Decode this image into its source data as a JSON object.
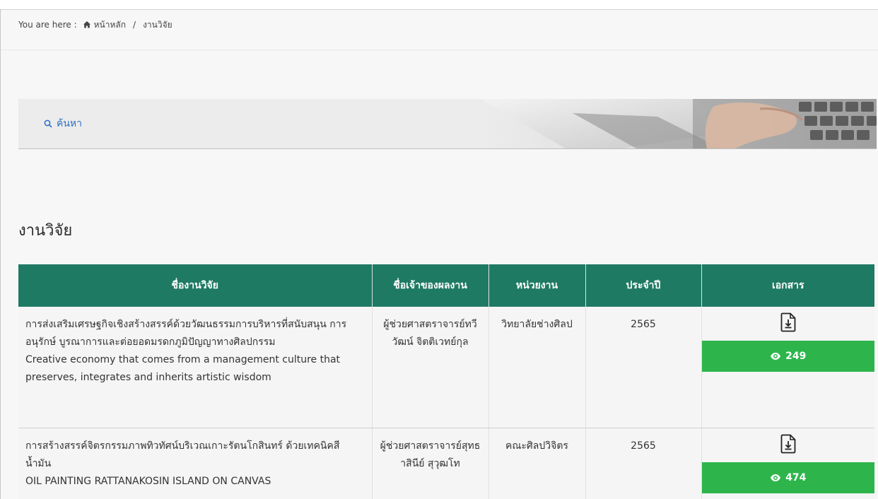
{
  "breadcrumb": {
    "prefix": "You are here :",
    "home_icon": "home-icon",
    "home_label": "หน้าหลัก",
    "separator": "/",
    "current": "งานวิจัย"
  },
  "search": {
    "icon": "search-icon",
    "label": "ค้นหา"
  },
  "section": {
    "title": "งานวิจัย"
  },
  "table": {
    "headers": [
      "ชื่องานวิจัย",
      "ชื่อเจ้าของผลงาน",
      "หน่วยงาน",
      "ประจำปี",
      "เอกสาร"
    ],
    "rows": [
      {
        "title_th": "การส่งเสริมเศรษฐกิจเชิงสร้างสรรค์ด้วยวัฒนธรรมการบริหารที่สนับสนุน การอนุรักษ์ บูรณาการและต่อยอดมรดกภูมิปัญญาทางศิลปกรรม",
        "title_en": "Creative economy that comes from a management culture that preserves, integrates and inherits artistic wisdom",
        "owner": "ผู้ช่วยศาสตราจารย์ทวีวัฒน์ จิตติเวทย์กุล",
        "department": "วิทยาลัยช่างศิลป",
        "year": "2565",
        "doc_icon": "file-download-icon",
        "views_icon": "eye-icon",
        "views": "249"
      },
      {
        "title_th": "การสร้างสรรค์จิตรกรรมภาพทิวทัศน์บริเวณเกาะรัตนโกสินทร์ ด้วยเทคนิคสีน้ำมัน",
        "title_en": "OIL PAINTING RATTANAKOSIN ISLAND ON CANVAS",
        "owner": "ผู้ช่วยศาสตราจารย์สุทธาสินีย์ สุวุฒโท",
        "department": "คณะศิลปวิจิตร",
        "year": "2565",
        "doc_icon": "file-download-icon",
        "views_icon": "eye-icon",
        "views": "474"
      }
    ]
  },
  "colors": {
    "header_green": "#1f7a63",
    "badge_green": "#2db54b",
    "link_blue": "#2f6fc6"
  }
}
